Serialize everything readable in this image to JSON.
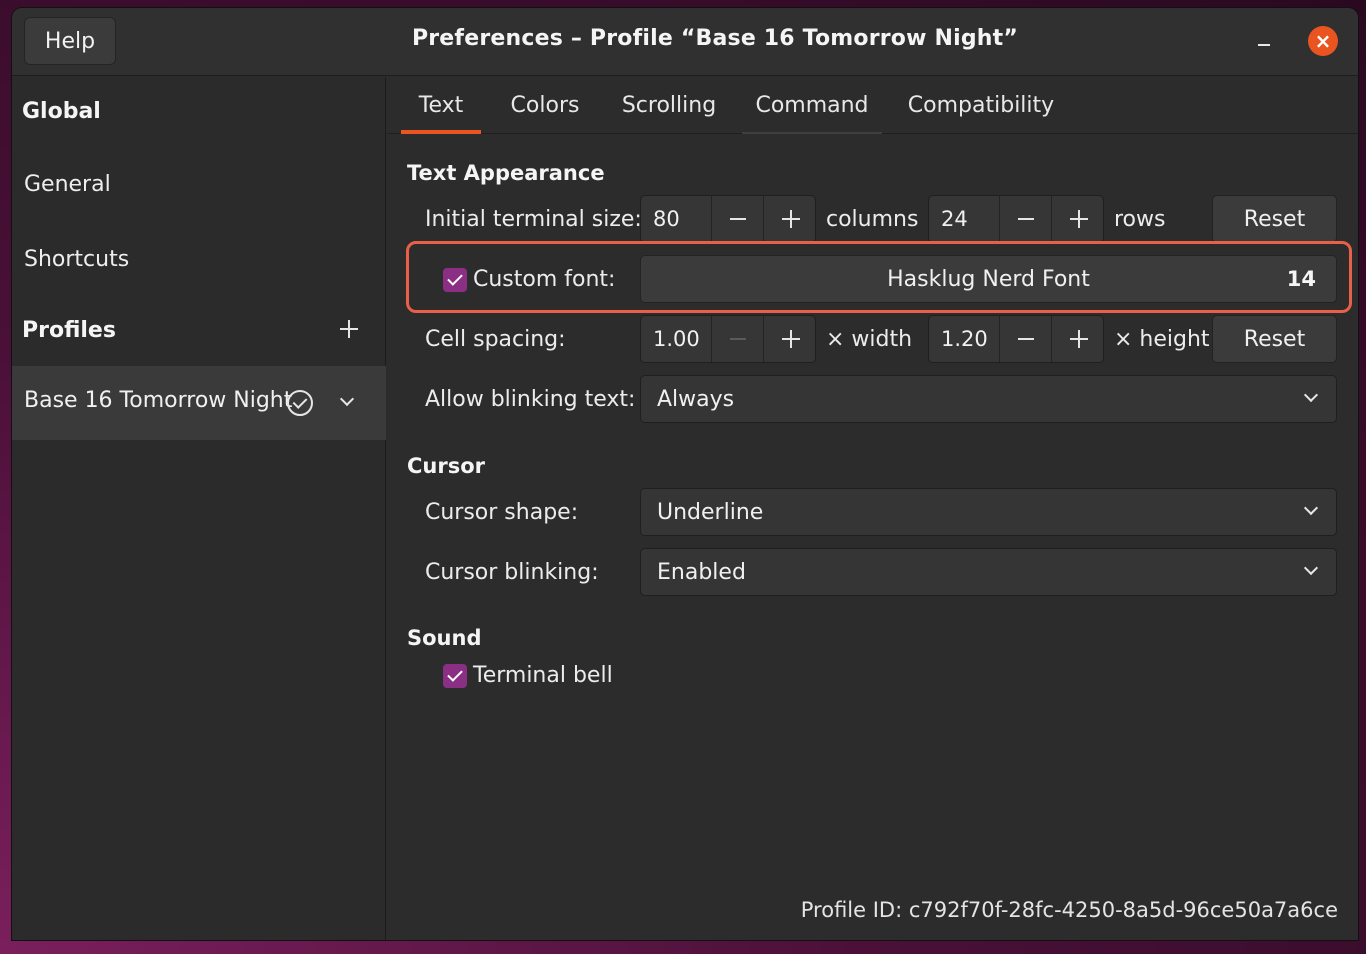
{
  "window": {
    "title": "Preferences – Profile “Base 16 Tomorrow Night”",
    "help_label": "Help",
    "minimize_icon": "minimize-icon",
    "close_icon": "close-icon",
    "close_color": "#e95420"
  },
  "sidebar": {
    "global_heading": "Global",
    "items": [
      {
        "label": "General"
      },
      {
        "label": "Shortcuts"
      }
    ],
    "profiles_heading": "Profiles",
    "add_icon": "plus-icon",
    "profile": {
      "name": "Base 16 Tomorrow Night",
      "default_icon": "check-circle-icon",
      "menu_icon": "chevron-down-icon"
    }
  },
  "tabs": [
    {
      "label": "Text",
      "active": true
    },
    {
      "label": "Colors",
      "active": false
    },
    {
      "label": "Scrolling",
      "active": false
    },
    {
      "label": "Command",
      "active": false
    },
    {
      "label": "Compatibility",
      "active": false
    }
  ],
  "text_appearance": {
    "heading": "Text Appearance",
    "initial_size": {
      "label": "Initial terminal size:",
      "columns": "80",
      "columns_unit": "columns",
      "rows": "24",
      "rows_unit": "rows",
      "reset_label": "Reset"
    },
    "custom_font": {
      "checked": true,
      "label": "Custom font:",
      "font_name": "Hasklug Nerd Font",
      "font_size": "14"
    },
    "cell_spacing": {
      "label": "Cell spacing:",
      "width": "1.00",
      "width_unit": "× width",
      "height": "1.20",
      "height_unit": "× height",
      "reset_label": "Reset"
    },
    "blinking_text": {
      "label": "Allow blinking text:",
      "value": "Always"
    }
  },
  "cursor": {
    "heading": "Cursor",
    "shape": {
      "label": "Cursor shape:",
      "value": "Underline"
    },
    "blinking": {
      "label": "Cursor blinking:",
      "value": "Enabled"
    }
  },
  "sound": {
    "heading": "Sound",
    "terminal_bell": {
      "checked": true,
      "label": "Terminal bell"
    }
  },
  "footer": {
    "profile_id": "Profile ID:  c792f70f-28fc-4250-8a5d-96ce50a7a6ce"
  },
  "colors": {
    "accent": "#e95420",
    "checkbox": "#8a2f84",
    "highlight_outline": "#e8604a"
  }
}
